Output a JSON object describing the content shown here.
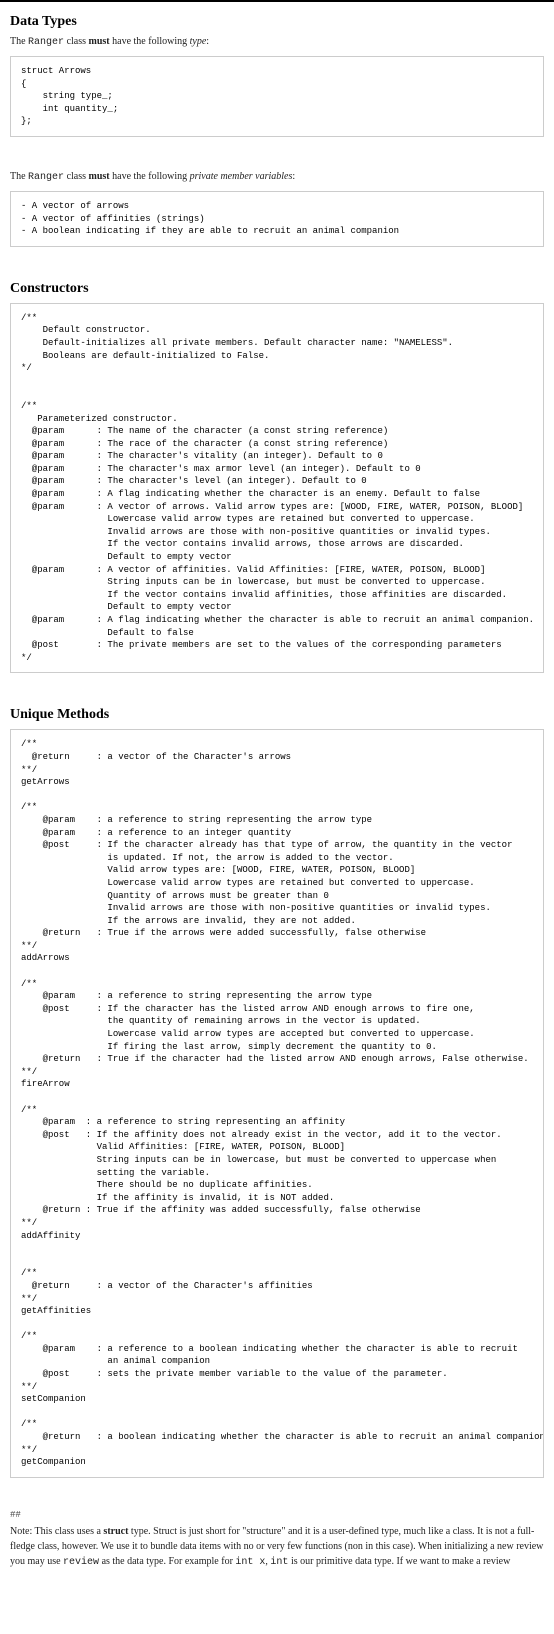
{
  "sections": {
    "data_types": {
      "heading": "Data Types",
      "intro_prefix": "The ",
      "intro_class": "Ranger",
      "intro_mid": " class ",
      "intro_bold": "must",
      "intro_suffix": " have the following ",
      "intro_italic": "type",
      "intro_colon": ":",
      "code": "struct Arrows\n{\n    string type_;\n    int quantity_;\n};",
      "vars_prefix": "The ",
      "vars_class": "Ranger",
      "vars_mid": " class ",
      "vars_bold": "must",
      "vars_suffix": " have the following ",
      "vars_italic": "private member variables",
      "vars_colon": ":",
      "vars_code": "- A vector of arrows\n- A vector of affinities (strings)\n- A boolean indicating if they are able to recruit an animal companion"
    },
    "constructors": {
      "heading": "Constructors",
      "code": "/**\n    Default constructor.\n    Default-initializes all private members. Default character name: \"NAMELESS\".\n    Booleans are default-initialized to False.\n*/\n\n\n/**\n   Parameterized constructor.\n  @param      : The name of the character (a const string reference)\n  @param      : The race of the character (a const string reference)\n  @param      : The character's vitality (an integer). Default to 0\n  @param      : The character's max armor level (an integer). Default to 0\n  @param      : The character's level (an integer). Default to 0\n  @param      : A flag indicating whether the character is an enemy. Default to false\n  @param      : A vector of arrows. Valid arrow types are: [WOOD, FIRE, WATER, POISON, BLOOD]\n                Lowercase valid arrow types are retained but converted to uppercase.\n                Invalid arrows are those with non-positive quantities or invalid types.\n                If the vector contains invalid arrows, those arrows are discarded.\n                Default to empty vector\n  @param      : A vector of affinities. Valid Affinities: [FIRE, WATER, POISON, BLOOD]\n                String inputs can be in lowercase, but must be converted to uppercase.\n                If the vector contains invalid affinities, those affinities are discarded.\n                Default to empty vector\n  @param      : A flag indicating whether the character is able to recruit an animal companion.\n                Default to false\n  @post       : The private members are set to the values of the corresponding parameters\n*/"
    },
    "methods": {
      "heading": "Unique Methods",
      "code": "/**\n  @return     : a vector of the Character's arrows\n**/\ngetArrows\n\n/**\n    @param    : a reference to string representing the arrow type\n    @param    : a reference to an integer quantity\n    @post     : If the character already has that type of arrow, the quantity in the vector\n                is updated. If not, the arrow is added to the vector.\n                Valid arrow types are: [WOOD, FIRE, WATER, POISON, BLOOD]\n                Lowercase valid arrow types are retained but converted to uppercase.\n                Quantity of arrows must be greater than 0\n                Invalid arrows are those with non-positive quantities or invalid types.\n                If the arrows are invalid, they are not added.\n    @return   : True if the arrows were added successfully, false otherwise\n**/\naddArrows\n\n/**\n    @param    : a reference to string representing the arrow type\n    @post     : If the character has the listed arrow AND enough arrows to fire one,\n                the quantity of remaining arrows in the vector is updated.\n                Lowercase valid arrow types are accepted but converted to uppercase.\n                If firing the last arrow, simply decrement the quantity to 0.\n    @return   : True if the character had the listed arrow AND enough arrows, False otherwise.\n**/\nfireArrow\n\n/**\n    @param  : a reference to string representing an affinity\n    @post   : If the affinity does not already exist in the vector, add it to the vector.\n              Valid Affinities: [FIRE, WATER, POISON, BLOOD]\n              String inputs can be in lowercase, but must be converted to uppercase when\n              setting the variable.\n              There should be no duplicate affinities.\n              If the affinity is invalid, it is NOT added.\n    @return : True if the affinity was added successfully, false otherwise\n**/\naddAffinity\n\n\n/**\n  @return     : a vector of the Character's affinities\n**/\ngetAffinities\n\n/**\n    @param    : a reference to a boolean indicating whether the character is able to recruit\n                an animal companion\n    @post     : sets the private member variable to the value of the parameter.\n**/\nsetCompanion\n\n/**\n    @return   : a boolean indicating whether the character is able to recruit an animal companion\n**/\ngetCompanion"
    }
  },
  "note": {
    "sep": "##",
    "prefix": "Note: This class uses a ",
    "struct": "struct",
    "mid1": " type. Struct is just short for \"structure\" and it is a user-defined type, much like a class. It is not a full-fledge class, however. We use it to bundle data items with no or very few functions (non in this case). When initializing a new review you may use ",
    "review": "review",
    "mid2": " as the data type. For example for ",
    "intx": "int x",
    "mid3": ", ",
    "int_t": "int",
    "suffix": " is our primitive data type. If we want to make a review"
  }
}
